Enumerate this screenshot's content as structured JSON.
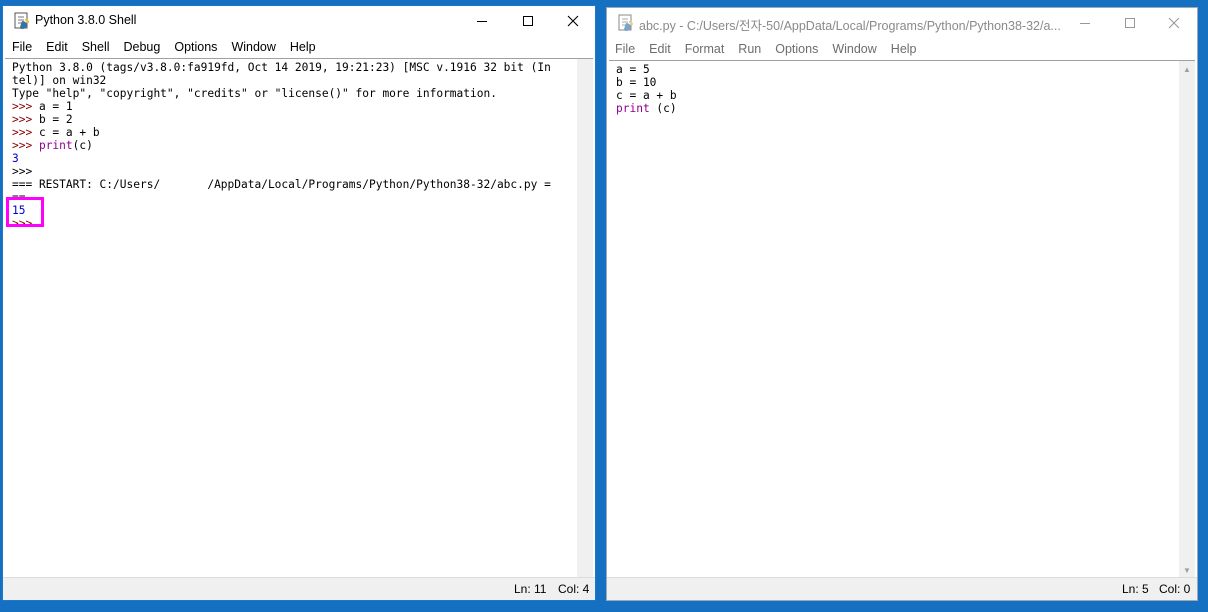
{
  "shell": {
    "title": "Python 3.8.0 Shell",
    "menu": [
      "File",
      "Edit",
      "Shell",
      "Debug",
      "Options",
      "Window",
      "Help"
    ],
    "lines": [
      {
        "type": "std",
        "text": "Python 3.8.0 (tags/v3.8.0:fa919fd, Oct 14 2019, 19:21:23) [MSC v.1916 32 bit (In"
      },
      {
        "type": "std",
        "text": "tel)] on win32"
      },
      {
        "type": "std",
        "text": "Type \"help\", \"copyright\", \"credits\" or \"license()\" for more information."
      },
      {
        "type": "prompt",
        "prompt": ">>> ",
        "code": "a = 1"
      },
      {
        "type": "prompt",
        "prompt": ">>> ",
        "code": "b = 2"
      },
      {
        "type": "prompt",
        "prompt": ">>> ",
        "code": "c = a + b"
      },
      {
        "type": "prompt_builtin",
        "prompt": ">>> ",
        "builtin": "print",
        "code": "(c)"
      },
      {
        "type": "result",
        "text": "3"
      },
      {
        "type": "std",
        "text": ">>> "
      },
      {
        "type": "std",
        "text": "=== RESTART: C:/Users/       /AppData/Local/Programs/Python/Python38-32/abc.py ="
      },
      {
        "type": "std",
        "text": "=="
      },
      {
        "type": "result",
        "text": "15"
      },
      {
        "type": "prompt_plain",
        "prompt": ">>> "
      }
    ],
    "status_ln": "Ln: 11",
    "status_col": "Col: 4"
  },
  "editor": {
    "title": "abc.py - C:/Users/전자-50/AppData/Local/Programs/Python/Python38-32/a...",
    "menu": [
      "File",
      "Edit",
      "Format",
      "Run",
      "Options",
      "Window",
      "Help"
    ],
    "lines": [
      {
        "type": "code",
        "text": "a = 5"
      },
      {
        "type": "code",
        "text": "b = 10"
      },
      {
        "type": "code",
        "text": "c = a + b"
      },
      {
        "type": "builtin",
        "builtin": "print",
        "code": " (c)"
      }
    ],
    "status_ln": "Ln: 5",
    "status_col": "Col: 0"
  },
  "colors": {
    "desktop": "#1570c2",
    "highlight": "#ff00ff",
    "prompt": "#8b0000",
    "builtin": "#900090",
    "result": "#0000cc"
  }
}
